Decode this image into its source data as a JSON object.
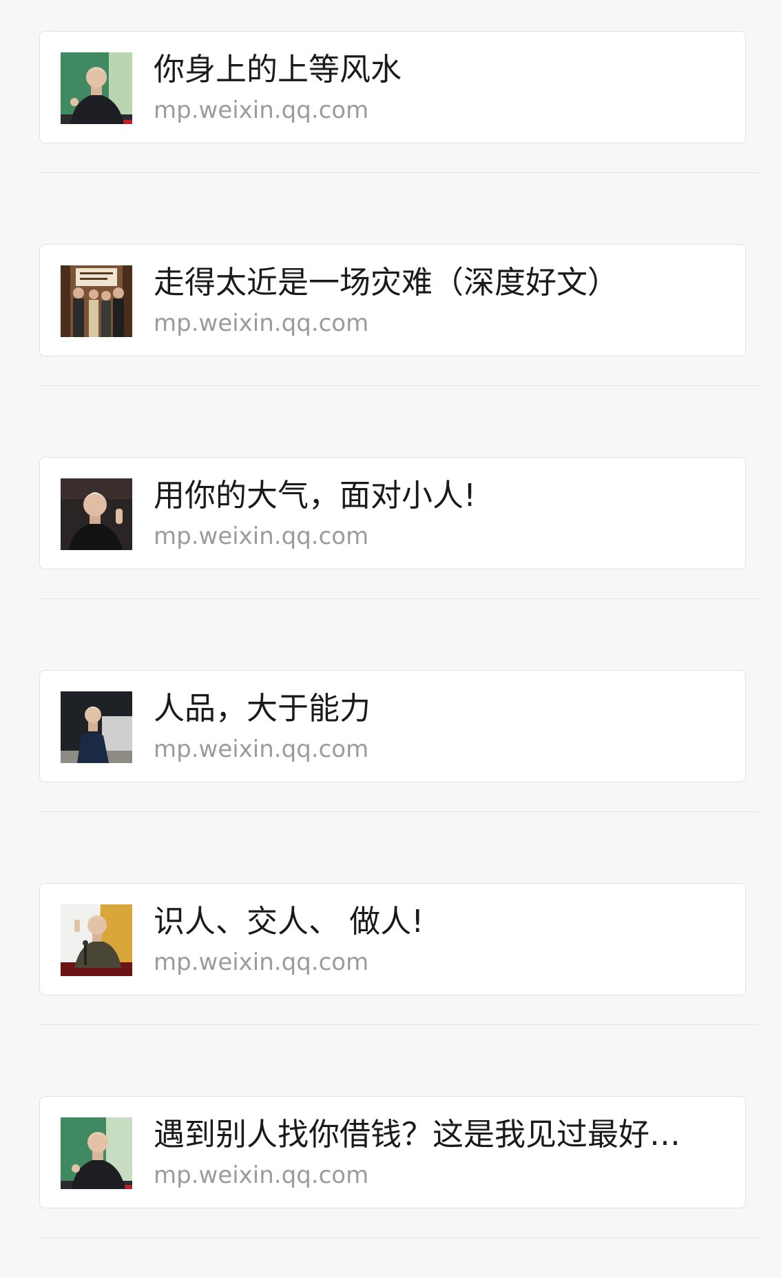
{
  "colors": {
    "page_background": "#f7f7f7",
    "card_background": "#ffffff",
    "title_text": "#1a1a1a",
    "domain_text": "#9b9b9b",
    "divider": "#e4e4e4"
  },
  "feed": {
    "items": [
      {
        "title": "你身上的上等风水",
        "domain": "mp.weixin.qq.com",
        "thumbnail": "elderly-man-portrait-green-background"
      },
      {
        "title": "走得太近是一场灾难（深度好文）",
        "domain": "mp.weixin.qq.com",
        "thumbnail": "group-photo-with-calligraphy-scroll"
      },
      {
        "title": "用你的大气，面对小人!",
        "domain": "mp.weixin.qq.com",
        "thumbnail": "elderly-man-speaking-dark-background"
      },
      {
        "title": "人品，大于能力",
        "domain": "mp.weixin.qq.com",
        "thumbnail": "elderly-man-seated-in-armchair"
      },
      {
        "title": "识人、交人、 做人!",
        "domain": "mp.weixin.qq.com",
        "thumbnail": "elderly-man-at-podium-with-microphone"
      },
      {
        "title": "遇到别人找你借钱？这是我见过最好…",
        "domain": "mp.weixin.qq.com",
        "thumbnail": "elderly-man-portrait-gesturing"
      }
    ]
  }
}
